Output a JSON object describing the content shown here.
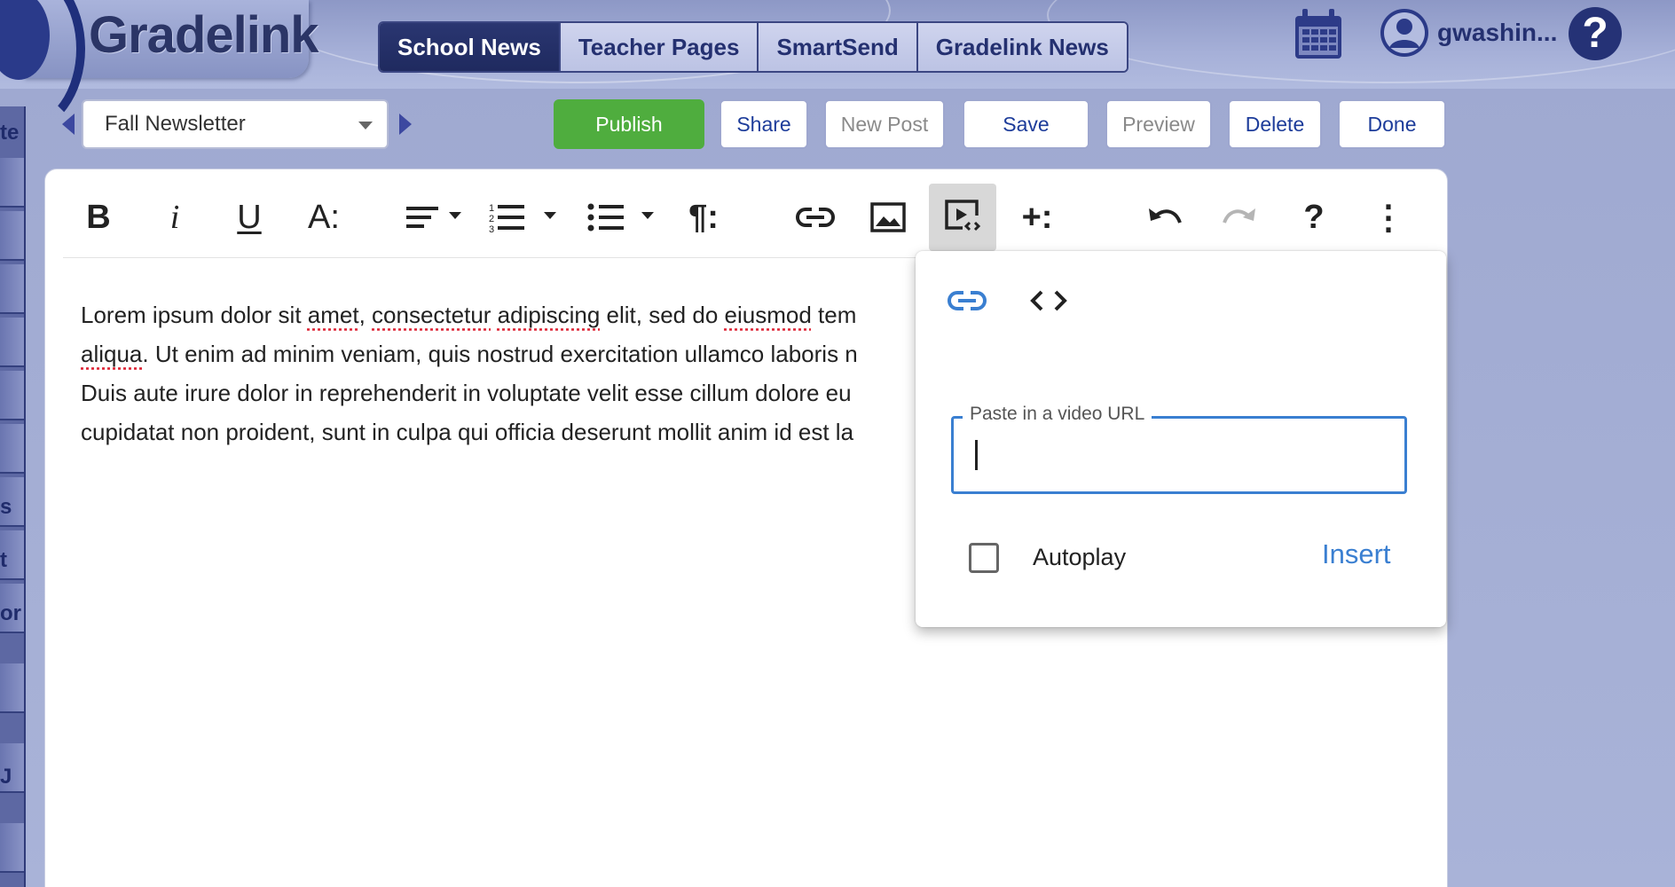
{
  "app": {
    "logo": "Gradelink"
  },
  "tabs": [
    {
      "label": "School News",
      "active": true
    },
    {
      "label": "Teacher Pages",
      "active": false
    },
    {
      "label": "SmartSend",
      "active": false
    },
    {
      "label": "Gradelink News",
      "active": false
    }
  ],
  "user": {
    "name": "gwashin...",
    "help_glyph": "?"
  },
  "left_strip": {
    "labels": [
      "te",
      "s",
      "t",
      "or",
      "J"
    ]
  },
  "newsletter_select": {
    "value": "Fall Newsletter"
  },
  "actions": {
    "publish": "Publish",
    "share": "Share",
    "new_post": "New Post",
    "save": "Save",
    "preview": "Preview",
    "delete": "Delete",
    "done": "Done"
  },
  "toolbar": {
    "bold": "B",
    "italic": "i",
    "underline": "U",
    "font_size": "A:",
    "paragraph": "¶:",
    "insert_more": "+:",
    "help": "?",
    "more": "⋮"
  },
  "content": {
    "lines": [
      [
        "Lorem ipsum dolor sit ",
        {
          "s": "amet"
        },
        ", ",
        {
          "s": "consectetur"
        },
        " ",
        {
          "s": "adipiscing"
        },
        " elit, sed do ",
        {
          "s": "eiusmod"
        },
        " tem"
      ],
      [
        {
          "s": "aliqua"
        },
        ". Ut enim ad minim veniam, quis nostrud exercitation ullamco laboris n"
      ],
      [
        "Duis aute irure dolor in reprehenderit in voluptate velit esse cillum dolore eu"
      ],
      [
        "cupidatat non proident, sunt in culpa qui officia deserunt mollit anim id est la"
      ]
    ]
  },
  "video_popup": {
    "url_label": "Paste in a video URL",
    "url_value": "",
    "autoplay_label": "Autoplay",
    "autoplay_checked": false,
    "insert_label": "Insert"
  },
  "colors": {
    "accent": "#3a7fd1",
    "publish": "#4fad3e",
    "header_dark": "#243070",
    "link_blue": "#1d3c9a"
  }
}
